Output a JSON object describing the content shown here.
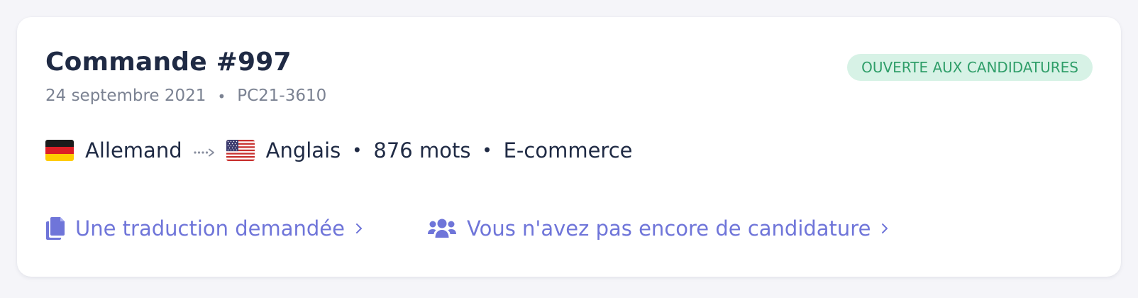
{
  "order": {
    "title": "Commande #997",
    "date": "24 septembre 2021",
    "separator": "•",
    "reference": "PC21-3610",
    "status": "Ouverte aux candidatures"
  },
  "languages": {
    "source": {
      "label": "Allemand",
      "flag": "germany-flag-icon"
    },
    "target": {
      "label": "Anglais",
      "flag": "usa-flag-icon"
    },
    "arrow_icon": "dotted-arrow-right-icon"
  },
  "details": {
    "word_count": "876 mots",
    "domain": "E-commerce",
    "separator": "•"
  },
  "links": {
    "translations": {
      "label": "Une traduction demandée",
      "icon": "documents-icon",
      "chevron": "chevron-right-icon"
    },
    "applications": {
      "label": "Vous n'avez pas encore de candidature",
      "icon": "users-icon",
      "chevron": "chevron-right-icon"
    }
  },
  "colors": {
    "title": "#1f2a44",
    "muted": "#7b8292",
    "accent": "#6f75d9",
    "status_bg": "#d7f2e6",
    "status_text": "#2f9e69"
  }
}
